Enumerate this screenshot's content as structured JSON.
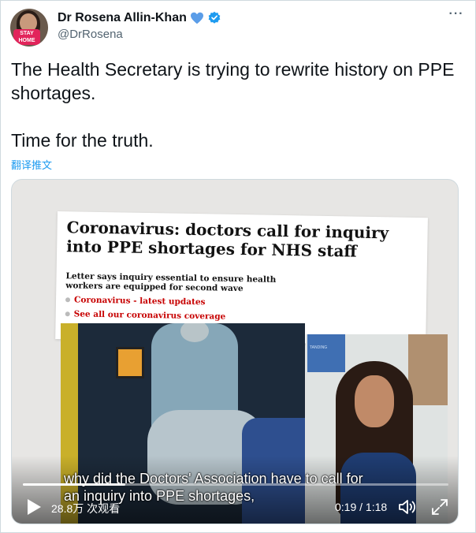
{
  "author": {
    "display_name": "Dr Rosena Allin-Khan",
    "handle": "@DrRosena",
    "avatar_badge": "STAY HOME",
    "heart_color": "#5b9de8",
    "verified_color": "#1d9bf0"
  },
  "tweet": {
    "line1": "The Health Secretary is trying to rewrite history on PPE shortages.",
    "line2": "Time for the truth.",
    "translate_link": "翻译推文"
  },
  "video": {
    "article": {
      "headline": "Coronavirus: doctors call for inquiry into PPE shortages for NHS staff",
      "standfirst": "Letter says inquiry essential to ensure health workers are equipped for second wave",
      "link1": "Coronavirus - latest updates",
      "link2": "See all our coronavirus coverage"
    },
    "poster_text": "TANDING",
    "caption_line1": "why did the Doctors' Association have to call for",
    "caption_line2": "an inquiry into PPE shortages,",
    "views": "28.8万 次观看",
    "time": "0:19 / 1:18",
    "progress_fraction": 0.24
  },
  "icons": {
    "more": "more-horizontal-icon",
    "play": "play-icon",
    "volume": "volume-icon",
    "fullscreen": "fullscreen-icon"
  }
}
